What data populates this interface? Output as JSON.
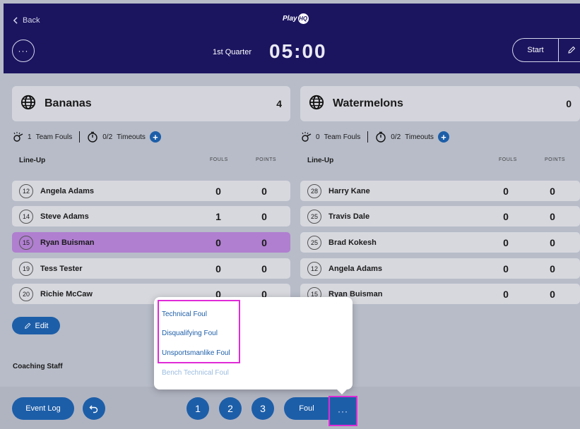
{
  "header": {
    "back_label": "Back",
    "logo_text": "Play",
    "logo_badge": "HQ",
    "menu_label": "···",
    "quarter": "1st Quarter",
    "clock": "05:00",
    "start_label": "Start"
  },
  "teams": [
    {
      "name": "Bananas",
      "score": "4",
      "team_fouls": "1",
      "team_fouls_label": "Team Fouls",
      "timeouts": "0/2",
      "timeouts_label": "Timeouts",
      "lineup_label": "Line-Up",
      "fouls_col": "FOULS",
      "points_col": "POINTS",
      "players": [
        {
          "num": "12",
          "name": "Angela Adams",
          "fouls": "0",
          "points": "0",
          "selected": false
        },
        {
          "num": "14",
          "name": "Steve Adams",
          "fouls": "1",
          "points": "0",
          "selected": false
        },
        {
          "num": "15",
          "name": "Ryan Buisman",
          "fouls": "0",
          "points": "0",
          "selected": true
        },
        {
          "num": "19",
          "name": "Tess Tester",
          "fouls": "0",
          "points": "0",
          "selected": false
        },
        {
          "num": "20",
          "name": "Richie McCaw",
          "fouls": "0",
          "points": "0",
          "selected": false
        }
      ]
    },
    {
      "name": "Watermelons",
      "score": "0",
      "team_fouls": "0",
      "team_fouls_label": "Team Fouls",
      "timeouts": "0/2",
      "timeouts_label": "Timeouts",
      "lineup_label": "Line-Up",
      "fouls_col": "FOULS",
      "points_col": "POINTS",
      "players": [
        {
          "num": "28",
          "name": "Harry Kane",
          "fouls": "0",
          "points": "0",
          "selected": false
        },
        {
          "num": "25",
          "name": "Travis Dale",
          "fouls": "0",
          "points": "0",
          "selected": false
        },
        {
          "num": "25",
          "name": "Brad Kokesh",
          "fouls": "0",
          "points": "0",
          "selected": false
        },
        {
          "num": "12",
          "name": "Angela Adams",
          "fouls": "0",
          "points": "0",
          "selected": false
        },
        {
          "num": "15",
          "name": "Ryan Buisman",
          "fouls": "0",
          "points": "0",
          "selected": false
        }
      ]
    }
  ],
  "edit_label": "Edit",
  "coaching_label": "Coaching Staff",
  "bottom": {
    "event_log_label": "Event Log",
    "point_buttons": [
      "1",
      "2",
      "3"
    ],
    "foul_label": "Foul",
    "more_label": "···"
  },
  "popup": {
    "options": [
      "Technical Foul",
      "Disqualifying Foul",
      "Unsportsmanlike Foul"
    ],
    "disabled_option": "Bench Technical Foul"
  },
  "colors": {
    "header_bg": "#1b1560",
    "accent_blue": "#1d5ea8",
    "selected_row": "#b07fd0",
    "highlight_magenta": "#e02bd7"
  }
}
